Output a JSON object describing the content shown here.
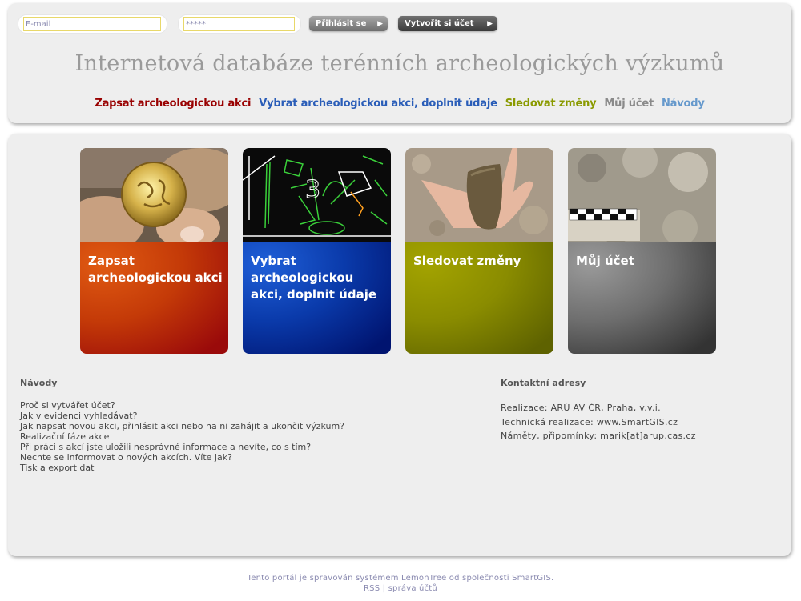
{
  "login": {
    "email_placeholder": "E-mail",
    "password_placeholder": "*****",
    "login_label": "Přihlásit se",
    "register_label": "Vytvořit si účet"
  },
  "header": {
    "title": "Internetová databáze terénních archeologických výzkumů"
  },
  "nav": {
    "items": [
      {
        "label": "Zapsat archeologickou akci",
        "color": "#990000"
      },
      {
        "label": "Vybrat archeologickou akci, doplnit údaje",
        "color": "#2a5db8"
      },
      {
        "label": "Sledovat změny",
        "color": "#8a9a00"
      },
      {
        "label": "Můj účet",
        "color": "#8a8a8a"
      },
      {
        "label": "Návody",
        "color": "#6699cc"
      }
    ]
  },
  "tiles": [
    {
      "label": "Zapsat archeologickou akci",
      "color": "#c43a08",
      "photo": "gold-coin-photo"
    },
    {
      "label": "Vybrat archeologickou akci, doplnit údaje",
      "color": "#0a3aaa",
      "photo": "cad-plan-photo"
    },
    {
      "label": "Sledovat změny",
      "color": "#8a8c00",
      "photo": "bone-in-hand-photo"
    },
    {
      "label": "Můj účet",
      "color": "#6e6e6e",
      "photo": "excavation-scale-photo"
    }
  ],
  "guides": {
    "title": "Návody",
    "items": [
      "Proč si vytvářet účet?",
      "Jak v evidenci vyhledávat?",
      "Jak napsat novou akci, přihlásit akci nebo na ni zahájit a ukončit výzkum?",
      "Realizační fáze akce",
      "Při práci s akcí jste uložili nesprávné informace a nevíte, co s tím?",
      "Nechte se informovat o nových akcích. Víte jak?",
      "Tisk a export dat"
    ]
  },
  "contact": {
    "title": "Kontaktní adresy",
    "items": [
      "Realizace: ARÚ AV ČR, Praha, v.v.i.",
      "Technická realizace: www.SmartGIS.cz",
      "Náměty, připomínky: marik[at]arup.cas.cz"
    ]
  },
  "footer": {
    "text": "Tento portál je spravován systémem LemonTree od společnosti SmartGIS.",
    "rss": "RSS",
    "separator": "|",
    "accounts": "správa účtů"
  }
}
